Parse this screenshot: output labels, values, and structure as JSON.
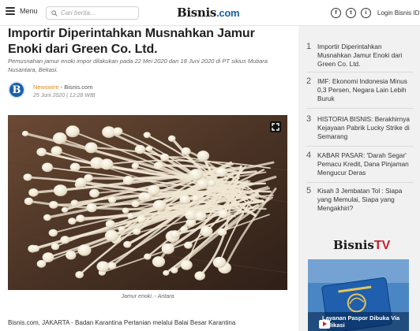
{
  "header": {
    "menu_label": "Menu",
    "search_placeholder": "Cari berita...",
    "logo_main": "Bisnis",
    "logo_suffix": ".com",
    "social": [
      "f",
      "t",
      "i"
    ],
    "login_label": "Login Bisnis ID"
  },
  "article": {
    "title": "Importir Diperintahkan Musnahkan Jamur Enoki dari Green Co. Ltd.",
    "excerpt": "Pemusnahan jamur enoki impor dilakukan pada 22 Mei 2020 dan 18 Juni 2020 di PT sikius Mutiara Nusantara, Bekasi.",
    "source_initial": "B",
    "source_channel": "Newswire",
    "source_separator": " - ",
    "source_site": "Bisnis.com",
    "date": "25 Juni 2020  |  12:28 WIB",
    "caption": "Jamur enoki. - Antara",
    "body_start": "Bisnis.com, JAKARTA - Badan Karantina Pertanian melalui Balai Besar Karantina"
  },
  "sidebar": {
    "items": [
      {
        "num": "1",
        "text": "Importir Diperintahkan Musnahkan Jamur Enoki dari Green Co. Ltd."
      },
      {
        "num": "2",
        "text": "IMF: Ekonomi Indonesia Minus 0,3 Persen, Negara Lain Lebih Buruk"
      },
      {
        "num": "3",
        "text": "HISTORIA BISNIS: Berakhirnya Kejayaan Pabrik Lucky Strike di Semarang"
      },
      {
        "num": "4",
        "text": "KABAR PASAR: 'Darah Segar' Pemacu Kredit, Dana Pinjaman Mengucur Deras"
      },
      {
        "num": "5",
        "text": "Kisah 3 Jembatan Tol : Siapa yang Memulai, Siapa yang Mengakhiri?"
      }
    ],
    "tv_logo_main": "Bisnis",
    "tv_logo_suffix": "TV",
    "tv_caption": "Layanan Paspor Dibuka Via Aplikasi"
  },
  "colors": {
    "brand_blue": "#1b5fa8",
    "tv_red": "#c8202f",
    "newswire_orange": "#e08a1e",
    "sidebar_bg": "#f1f1f1"
  }
}
